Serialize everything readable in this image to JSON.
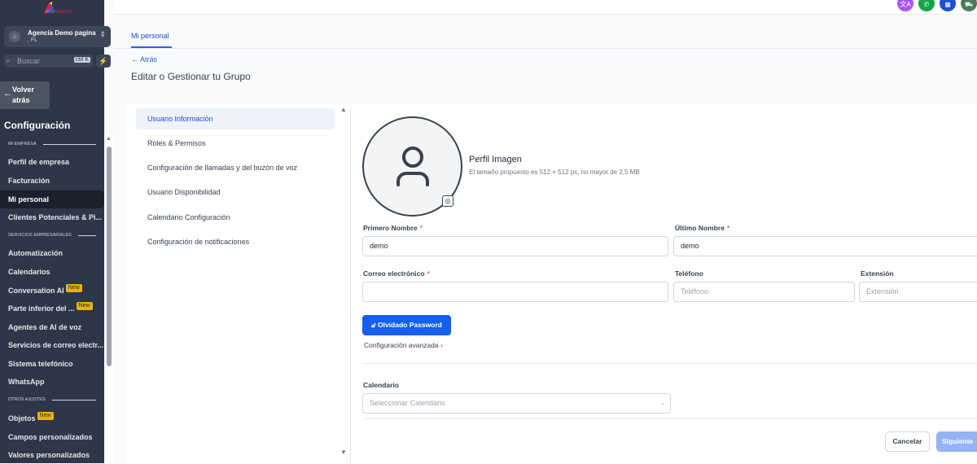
{
  "sidebar": {
    "logo_text": "WEB",
    "account_name": "Agencia Demo pagina",
    "account_sub": ", FL",
    "search_placeholder": "Buscar",
    "search_shortcut": "ctrl K",
    "back_label": "Volver atrás",
    "heading": "Configuración",
    "sections": [
      "MI EMPRESA",
      "SERVICIOS EMPRESARIALES",
      "OTROS AJUSTES"
    ],
    "items": [
      "Perfil de empresa",
      "Facturación",
      "Mi personal",
      "Clientes Potenciales & Pi...",
      "Automatización",
      "Calendarios",
      "Conversation AI",
      "Parte inferior del ...",
      "Agentes de AI de voz",
      "Servicios de correo electr...",
      "Sistema telefónico",
      "WhatsApp",
      "Objetos",
      "Campos personalizados",
      "Valores personalizados"
    ],
    "new_badge": "New"
  },
  "header": {
    "tab": "Mi personal",
    "back": "← Atrás",
    "title": "Editar o Gestionar tu Grupo"
  },
  "menu": [
    "Usuario Información",
    "Roles & Permisos",
    "Configuración de llamadas y del buzón de voz",
    "Usuario Disponibilidad",
    "Calendario Configuración",
    "Configuración de notificaciones"
  ],
  "form": {
    "profile_title": "Perfil Imagen",
    "profile_sub": "El tamaño propuesto es 512 × 512 px, no mayor de 2,5 MB",
    "first_name_label": "Primero Nombre",
    "first_name": "demo",
    "last_name_label": "Último Nombre",
    "last_name": "demo",
    "email_label": "Correo electrónico",
    "email": "",
    "phone_label": "Teléfono",
    "phone_placeholder": "Teléfono",
    "ext_label": "Extensión",
    "ext_placeholder": "Extensión",
    "required": "*",
    "password_button": "Olvidado Password",
    "advanced": "Configuración avanzada",
    "calendar_label": "Calendario",
    "calendar_placeholder": "Seleccionar Calendario",
    "cancel": "Cancelar",
    "next": "Siguiente"
  },
  "colors": {
    "sidebar": "#2d3748",
    "primary": "#155eef"
  }
}
